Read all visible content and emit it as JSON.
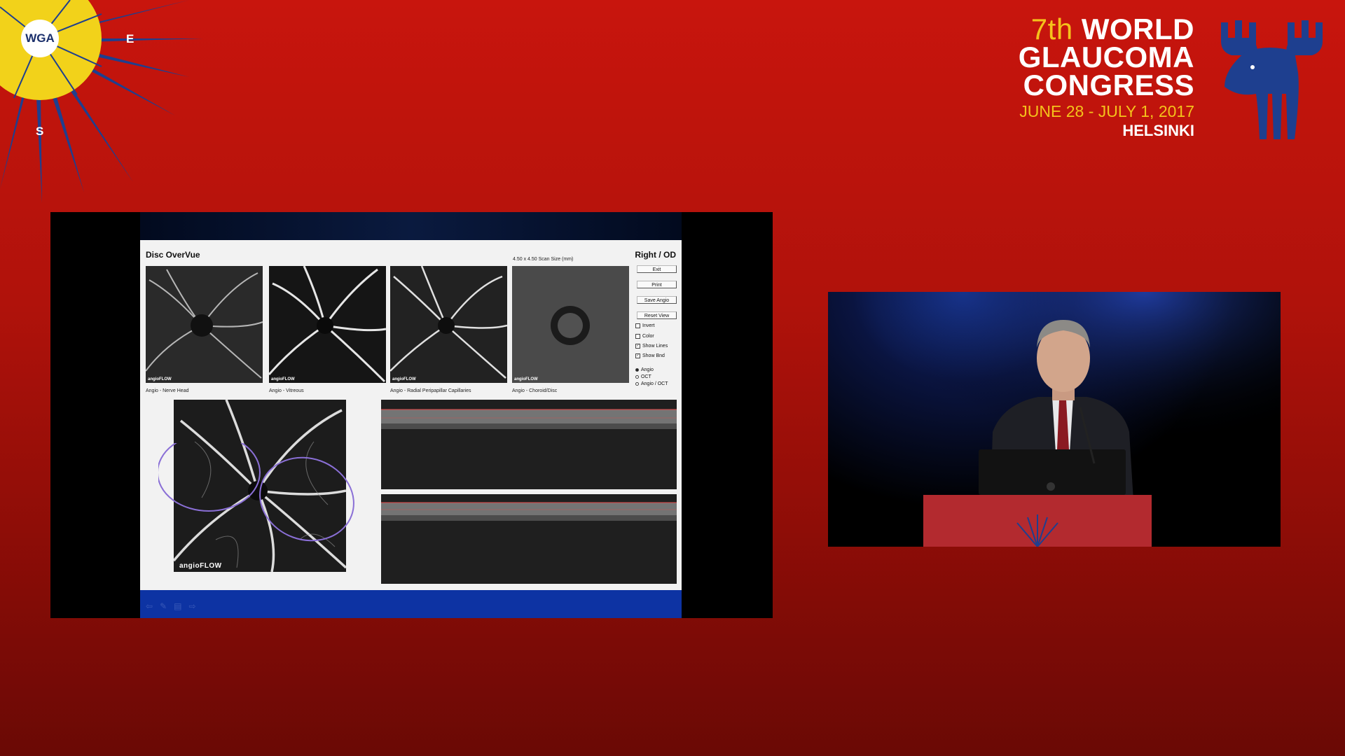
{
  "branding": {
    "wga_badge": "WGA",
    "compass_east": "E",
    "compass_south": "S",
    "congress_ordinal": "7th",
    "congress_word1": "WORLD",
    "congress_word2": "GLAUCOMA",
    "congress_word3": "CONGRESS",
    "congress_dates": "JUNE 28 - JULY 1, 2017",
    "congress_city": "HELSINKI",
    "accent_color": "#f4c21b",
    "background_color": "#c8150d"
  },
  "slide": {
    "panel_title": "Disc OverVue",
    "eye_side": "Right / OD",
    "scan_size": "4.50 x 4.50 Scan Size (mm)",
    "thumbnails": [
      {
        "caption": "Angio - Nerve Head",
        "watermark": "angioFLOW"
      },
      {
        "caption": "Angio - Vitreous",
        "watermark": "angioFLOW"
      },
      {
        "caption": "Angio - Radial Peripapillar Capillaries",
        "watermark": "angioFLOW"
      },
      {
        "caption": "Angio - Choroid/Disc",
        "watermark": "angioFLOW"
      }
    ],
    "buttons": {
      "exit": "Exit",
      "print": "Print",
      "save_angio": "Save Angio",
      "reset_view": "Reset View"
    },
    "checkboxes": [
      {
        "label": "Invert",
        "checked": false
      },
      {
        "label": "Color",
        "checked": false
      },
      {
        "label": "Show Lines",
        "checked": true
      },
      {
        "label": "Show Bnd",
        "checked": true
      }
    ],
    "radios": [
      {
        "label": "Angio",
        "selected": true
      },
      {
        "label": "OCT",
        "selected": false
      },
      {
        "label": "Angio / OCT",
        "selected": false
      }
    ],
    "large_watermark": "angioFLOW",
    "annotation_color": "#8a6fd6"
  }
}
